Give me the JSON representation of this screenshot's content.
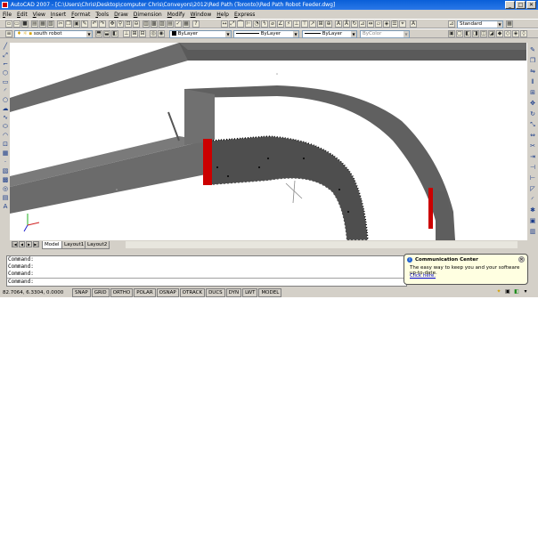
{
  "window": {
    "title": "AutoCAD 2007 - [C:\\Users\\Chris\\Desktop\\computer Chris\\Conveyors\\2012\\Red Path (Toronto)\\Red Path Robot Feeder.dwg]",
    "minimize": "_",
    "maximize": "□",
    "close": "✕"
  },
  "menu": [
    "File",
    "Edit",
    "View",
    "Insert",
    "Format",
    "Tools",
    "Draw",
    "Dimension",
    "Modify",
    "Window",
    "Help",
    "Express"
  ],
  "toolbar": {
    "text_style": "Standard",
    "layer": "south robot",
    "color": "ByLayer",
    "linetype": "ByLayer",
    "lineweight": "ByLayer",
    "plotstyle": "ByColor"
  },
  "tabs": [
    "Model",
    "Layout1",
    "Layout2"
  ],
  "command": {
    "lines": [
      "Command:",
      "Command:",
      "Command:"
    ],
    "prompt": "Command:"
  },
  "status": {
    "coords": "82.7064, 6.3304, 0.0000",
    "buttons": [
      "SNAP",
      "GRID",
      "ORTHO",
      "POLAR",
      "OSNAP",
      "OTRACK",
      "DUCS",
      "DYN",
      "LWT",
      "MODEL"
    ]
  },
  "balloon": {
    "title": "Communication Center",
    "message": "The easy way to keep you and your software up-to-date.",
    "link": "Click here."
  },
  "colors": {
    "beam": "#6b6b6b",
    "beam_dark": "#4e4e4e",
    "highlight": "#cc0000",
    "titlebar": "#0a5fd8"
  },
  "icons": {
    "toolbar1": [
      "new-icon",
      "open-icon",
      "save-icon",
      "plot-icon",
      "preview-icon",
      "publish-icon",
      "cut-icon",
      "copy-icon",
      "paste-icon",
      "matchprop-icon",
      "undo-icon",
      "redo-icon",
      "pan-icon",
      "zoom-icon",
      "zoom-window-icon",
      "zoom-prev-icon",
      "properties-icon",
      "designcenter-icon",
      "toolpalettes-icon",
      "sheetset-icon",
      "markup-icon",
      "calculator-icon",
      "help-icon"
    ],
    "left": [
      "line-icon",
      "xline-icon",
      "polyline-icon",
      "polygon-icon",
      "rectangle-icon",
      "arc-icon",
      "circle-icon",
      "revcloud-icon",
      "spline-icon",
      "ellipse-icon",
      "ellipse-arc-icon",
      "insert-icon",
      "block-icon",
      "point-icon",
      "hatch-icon",
      "gradient-icon",
      "region-icon",
      "table-icon",
      "mtext-icon"
    ],
    "right": [
      "erase-icon",
      "copy-object-icon",
      "mirror-icon",
      "offset-icon",
      "array-icon",
      "move-icon",
      "rotate-icon",
      "scale-icon",
      "stretch-icon",
      "trim-icon",
      "extend-icon",
      "break-icon",
      "join-icon",
      "chamfer-icon",
      "fillet-icon",
      "explode-icon"
    ]
  }
}
